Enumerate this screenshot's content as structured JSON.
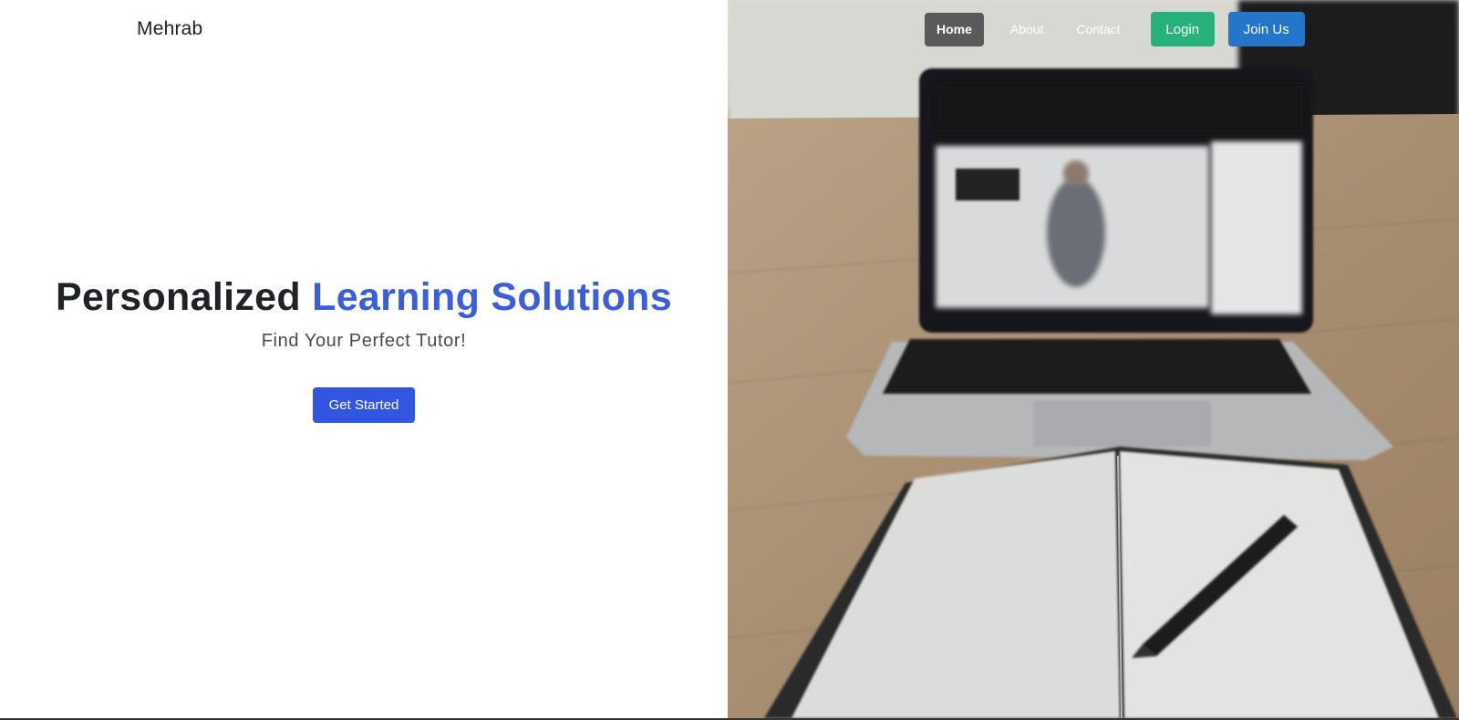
{
  "brand": {
    "name": "Mehrab"
  },
  "nav": {
    "home": "Home",
    "about": "About",
    "contact": "Contact",
    "login": "Login",
    "join": "Join Us"
  },
  "hero": {
    "title_part1": "Personalized",
    "title_accent": "Learning Solutions",
    "subtitle": "Find Your Perfect Tutor!",
    "cta": "Get Started"
  },
  "colors": {
    "accent": "#3b5fdc",
    "cta": "#3356e0",
    "login": "#26b27a",
    "join": "#2376c9",
    "nav_active": "#5a5a5a"
  }
}
